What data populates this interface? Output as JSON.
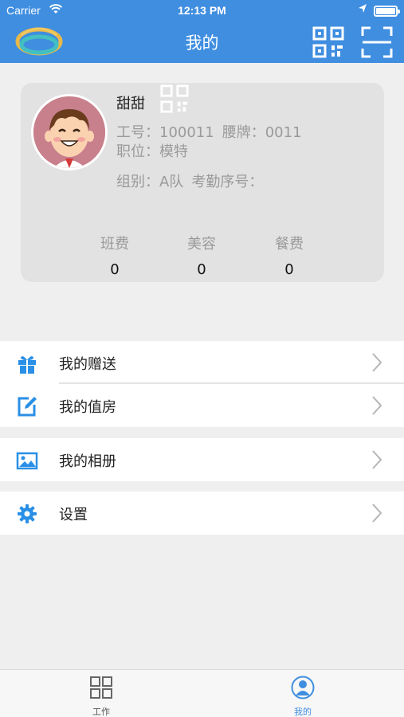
{
  "status_bar": {
    "carrier": "Carrier",
    "time": "12:13 PM"
  },
  "header": {
    "title": "我的"
  },
  "profile": {
    "name": "甜甜",
    "employee_no_label": "工号：",
    "employee_no": "100011",
    "badge_label": "腰牌：",
    "badge": "0011",
    "position_label": "职位：",
    "position": "模特",
    "group_label": "组别：",
    "group": "A队",
    "attendance_label": "考勤序号："
  },
  "stats": [
    {
      "label": "班费",
      "value": "0"
    },
    {
      "label": "美容",
      "value": "0"
    },
    {
      "label": "餐费",
      "value": "0"
    }
  ],
  "menu": {
    "gifts": "我的赠送",
    "room_duty": "我的值房",
    "album": "我的相册",
    "settings": "设置"
  },
  "tabbar": {
    "work": "工作",
    "mine": "我的"
  },
  "colors": {
    "brand_blue": "#3f8ee0",
    "icon_blue": "#2a8fe6",
    "background": "#efefef"
  },
  "icons": {
    "logo": "company-logo",
    "qr": "qr-code-icon",
    "scan": "scan-icon",
    "gift": "gift-icon",
    "edit": "edit-icon",
    "album": "image-icon",
    "settings": "gear-icon",
    "chevron": "chevron-right-icon",
    "tab_work": "grid-icon",
    "tab_mine": "user-icon"
  }
}
